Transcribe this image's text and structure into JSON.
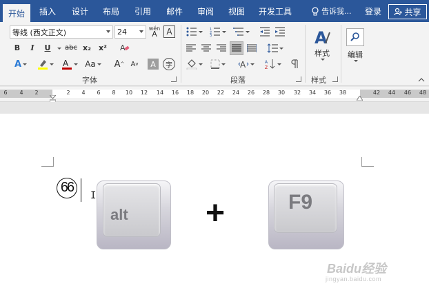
{
  "tabs": [
    "开始",
    "插入",
    "设计",
    "布局",
    "引用",
    "邮件",
    "审阅",
    "视图",
    "开发工具"
  ],
  "active_tab": "开始",
  "tell_me_label": "告诉我...",
  "login_label": "登录",
  "share_label": "共享",
  "font": {
    "name": "等线 (西文正文)",
    "size": "24"
  },
  "font_buttons": {
    "bold": "B",
    "italic": "I",
    "underline": "U",
    "strike": "abc",
    "subscript": "x₂",
    "superscript": "x²",
    "case": "Aa",
    "grow": "A",
    "shrink": "A",
    "char_border": "A",
    "enclose": "字",
    "phonetic": "wén",
    "phonetic_a": "A"
  },
  "groups": {
    "font": "字体",
    "paragraph": "段落",
    "styles": "样式"
  },
  "styles_button": "样式",
  "editing_button": "编辑",
  "ruler_ticks": [
    "6",
    "4",
    "2",
    "2",
    "4",
    "6",
    "8",
    "10",
    "12",
    "14",
    "16",
    "18",
    "20",
    "22",
    "24",
    "26",
    "28",
    "30",
    "32",
    "34",
    "36",
    "38",
    "42",
    "44",
    "46",
    "48"
  ],
  "doc": {
    "circled_number": "66",
    "key1": "alt",
    "plus": "+",
    "key2": "F9"
  },
  "watermark": {
    "logo": "Baidu经验",
    "url": "jingyan.baidu.com"
  },
  "colors": {
    "accent": "#2b579a",
    "highlight": "#ffff00",
    "font_color": "#c00000"
  }
}
